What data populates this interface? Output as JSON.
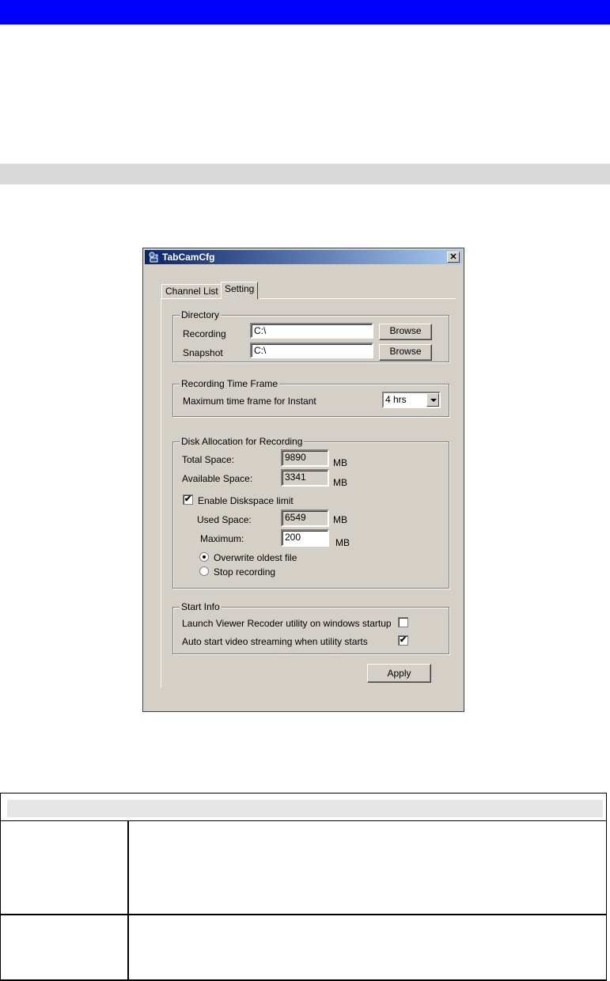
{
  "window": {
    "title": "TabCamCfg",
    "close_glyph": "✕",
    "tabs": [
      {
        "label": "Channel List",
        "active": false
      },
      {
        "label": "Setting",
        "active": true
      }
    ]
  },
  "directory": {
    "legend": "Directory",
    "recording_label": "Recording",
    "recording_value": "C:\\",
    "snapshot_label": "Snapshot",
    "snapshot_value": "C:\\",
    "browse_label": "Browse"
  },
  "time_frame": {
    "legend": "Recording Time Frame",
    "max_label": "Maximum time frame for Instant",
    "selected": "4 hrs"
  },
  "disk": {
    "legend": "Disk Allocation for Recording",
    "total_label": "Total Space:",
    "total_value": "9890",
    "available_label": "Available Space:",
    "available_value": "3341",
    "unit": "MB",
    "enable_label": "Enable Diskspace limit",
    "enable_checked": true,
    "used_label": "Used Space:",
    "used_value": "6549",
    "maximum_label": "Maximum:",
    "maximum_value": "200",
    "overwrite_label": "Overwrite oldest file",
    "stop_label": "Stop recording",
    "selected_option": "Overwrite oldest file"
  },
  "start_info": {
    "legend": "Start Info",
    "launch_label": "Launch Viewer Recoder utility on windows startup",
    "launch_checked": false,
    "autostart_label": "Auto start video streaming when utility starts",
    "autostart_checked": true
  },
  "apply_label": "Apply",
  "check_glyph": "✔",
  "colors": {
    "top_bar": "#0000ff",
    "section_bar": "#d9d9d9",
    "dialog_face": "#d4d0c8",
    "title_gradient_start": "#0a246a",
    "title_gradient_end": "#a6caf0"
  }
}
